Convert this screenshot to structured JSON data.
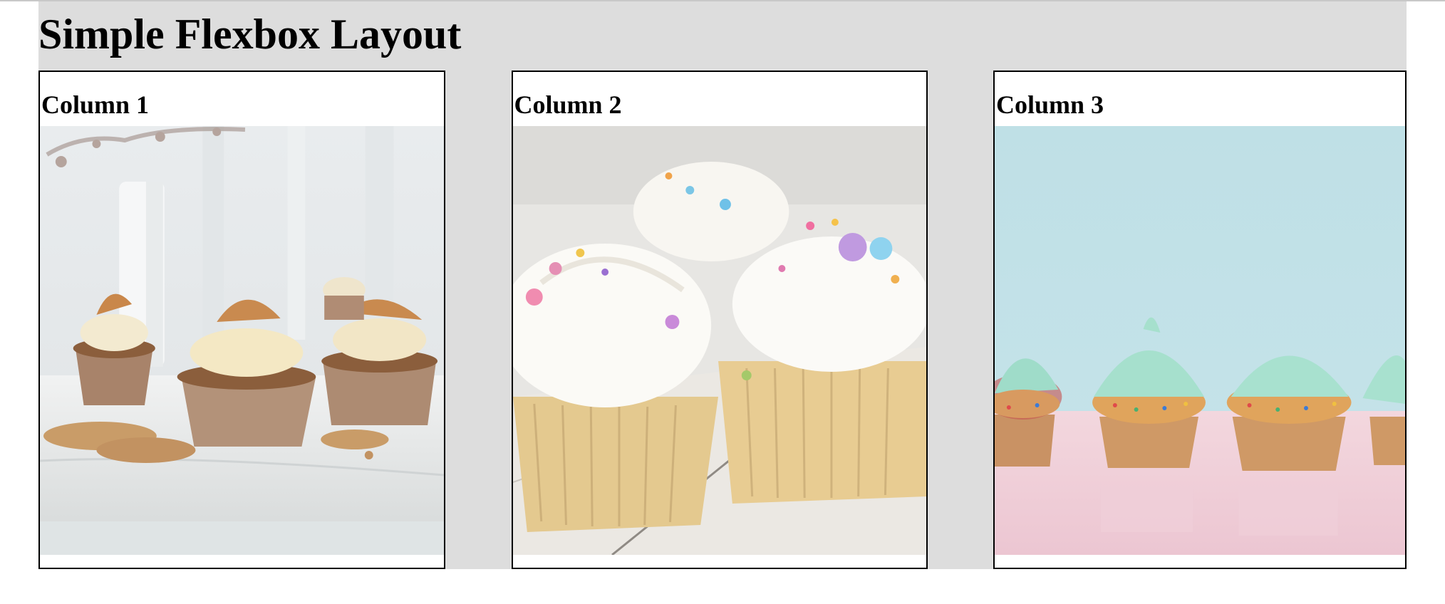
{
  "page": {
    "title": "Simple Flexbox Layout",
    "background_color": "#dddddd"
  },
  "columns": [
    {
      "title": "Column 1",
      "image": "cupcakes-with-waffle-cookies-photo"
    },
    {
      "title": "Column 2",
      "image": "vanilla-cupcakes-with-sprinkles-photo"
    },
    {
      "title": "Column 3",
      "image": "mint-frosted-cupcakes-on-pink-photo"
    }
  ]
}
